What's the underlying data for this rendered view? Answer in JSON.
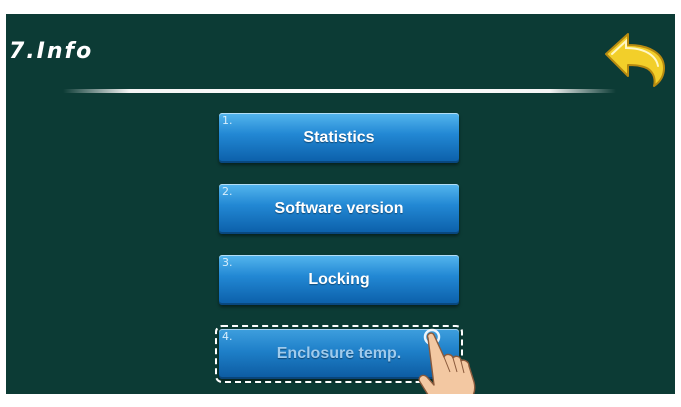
{
  "header": {
    "title": "7.Info"
  },
  "menu": {
    "items": [
      {
        "number": "1.",
        "label": "Statistics"
      },
      {
        "number": "2.",
        "label": "Software version"
      },
      {
        "number": "3.",
        "label": "Locking"
      },
      {
        "number": "4.",
        "label": "Enclosure temp.",
        "selected": true
      }
    ]
  },
  "icons": {
    "back": "back-arrow-icon",
    "pointer": "hand-pointer-icon"
  },
  "colors": {
    "background": "#0c3b35",
    "button": "#2288d4",
    "back_arrow": "#f2cf2a"
  }
}
